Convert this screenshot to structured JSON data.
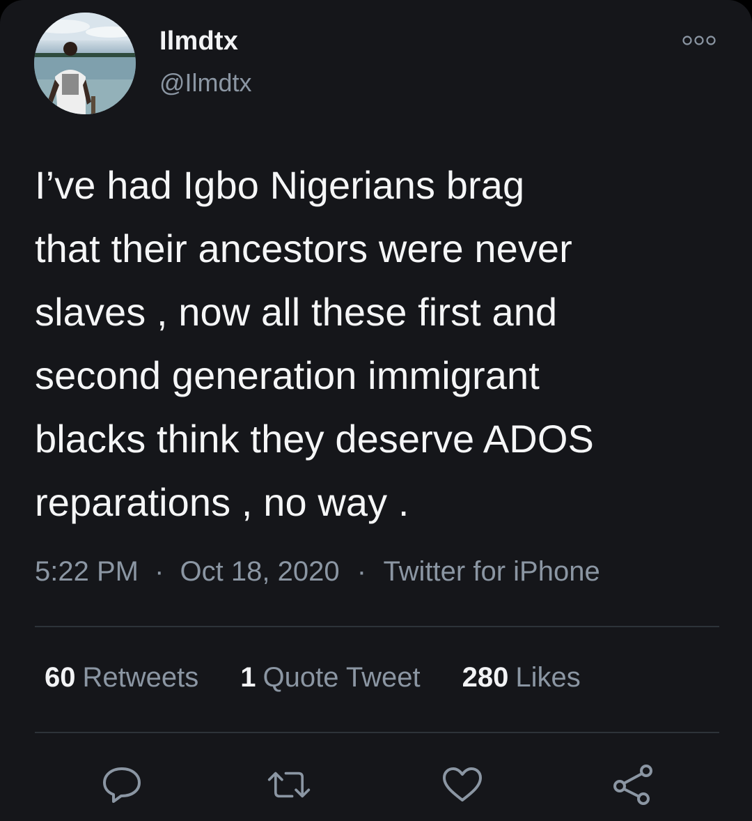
{
  "author": {
    "display_name": "Ilmdtx",
    "handle": "@Ilmdtx"
  },
  "tweet": {
    "text": "I’ve had Igbo Nigerians brag\nthat their ancestors were never\nslaves , now all these first and\nsecond generation immigrant\nblacks think they deserve ADOS\nreparations , no way .",
    "time": "5:22 PM",
    "date": "Oct 18, 2020",
    "source": "Twitter for iPhone",
    "separator": "·"
  },
  "stats": {
    "retweets_count": "60",
    "retweets_label": "Retweets",
    "quotes_count": "1",
    "quotes_label": "Quote Tweet",
    "likes_count": "280",
    "likes_label": "Likes"
  },
  "icons": {
    "more": "more-options-icon",
    "reply": "reply-icon",
    "retweet": "retweet-icon",
    "like": "heart-icon",
    "share": "share-icon"
  },
  "colors": {
    "background": "#15161a",
    "text_primary": "#f5f6f7",
    "text_secondary": "#8b96a3",
    "divider": "#2d3339"
  }
}
